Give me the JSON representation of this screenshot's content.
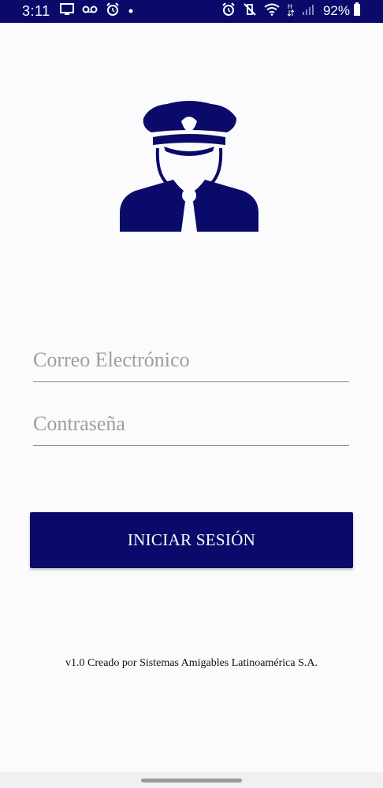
{
  "status_bar": {
    "time": "3:11",
    "battery_percent": "92%",
    "left_icons": [
      "screen-cast-icon",
      "voicemail-icon",
      "alarm-icon",
      "dot-icon"
    ],
    "right_icons": [
      "alarm-icon",
      "vibrate-mute-icon",
      "wifi-icon",
      "data-hplus-icon",
      "signal-icon",
      "battery-icon"
    ]
  },
  "avatar": {
    "icon": "police-officer-icon",
    "color": "#0a0a6b"
  },
  "form": {
    "email_placeholder": "Correo Electrónico",
    "password_placeholder": "Contraseña",
    "submit_label": "INICIAR SESIÓN"
  },
  "footer": {
    "text": "v1.0 Creado por Sistemas Amigables Latinoamérica S.A."
  },
  "colors": {
    "primary": "#0a0a6b",
    "background": "#fbfbfd",
    "underline": "#8a8a8a",
    "placeholder": "#9e9e9e"
  }
}
